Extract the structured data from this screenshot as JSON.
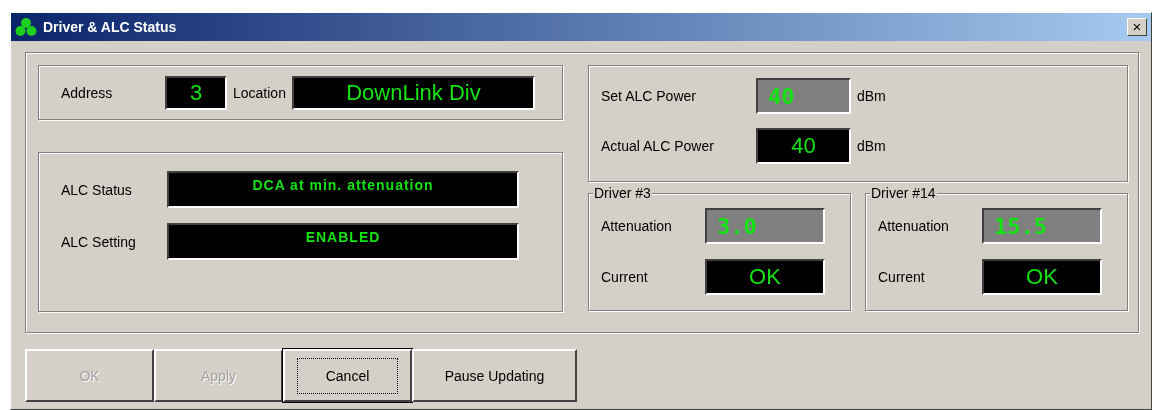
{
  "window": {
    "title": "Driver & ALC Status",
    "close": "×"
  },
  "address": {
    "label": "Address",
    "value": "3",
    "location_label": "Location",
    "location": "DownLink Div"
  },
  "alc": [
    {
      "label": "ALC Status",
      "value": "DCA at min. attenuation"
    },
    {
      "label": "ALC Setting",
      "value": "ENABLED"
    }
  ],
  "power": [
    {
      "label": "Set ALC Power",
      "value": "40",
      "kind": "setpoint",
      "unit": "dBm"
    },
    {
      "label": "Actual ALC Power",
      "value": "40",
      "kind": "readout",
      "unit": "dBm"
    }
  ],
  "drivers": [
    {
      "title": "Driver #3",
      "rows": [
        {
          "label": "Attenuation",
          "value": "3.0",
          "kind": "setpoint"
        },
        {
          "label": "Current",
          "value": "OK",
          "kind": "readout"
        }
      ]
    },
    {
      "title": "Driver #14",
      "rows": [
        {
          "label": "Attenuation",
          "value": "15.5",
          "kind": "setpoint"
        },
        {
          "label": "Current",
          "value": "OK",
          "kind": "readout"
        }
      ]
    }
  ],
  "buttons": [
    {
      "label": "OK",
      "disabled": true,
      "focused": false
    },
    {
      "label": "Apply",
      "disabled": true,
      "focused": false
    },
    {
      "label": "Cancel",
      "disabled": false,
      "focused": true
    },
    {
      "label": "Pause Updating",
      "disabled": false,
      "focused": false
    }
  ]
}
